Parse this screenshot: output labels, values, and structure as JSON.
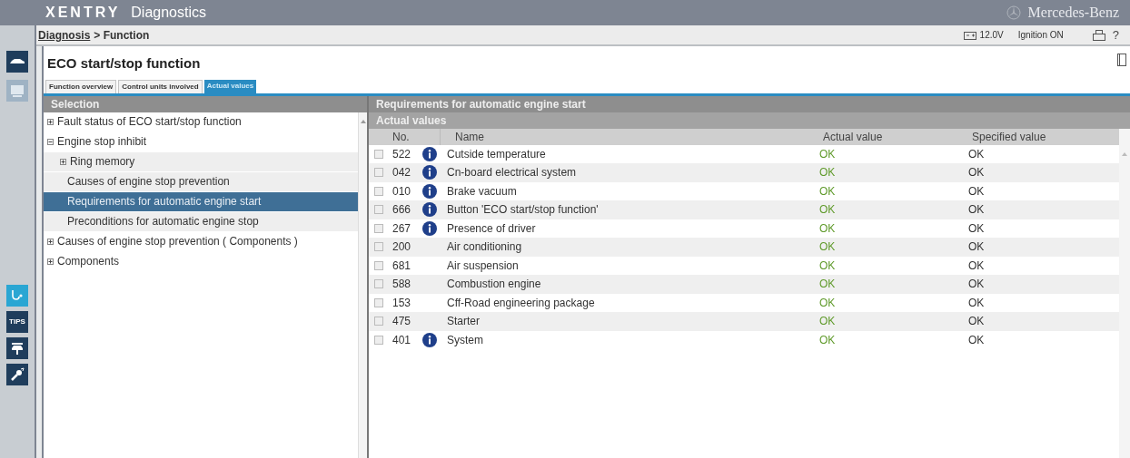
{
  "app": {
    "brand": "XENTRY",
    "title": "Diagnostics",
    "maker": "Mercedes-Benz"
  },
  "breadcrumb": {
    "link": "Diagnosis",
    "current": "> Function"
  },
  "status": {
    "voltage": "12.0V",
    "ignition": "Ignition ON"
  },
  "help": "?",
  "sidebar": {
    "top": [
      {
        "kind": "car",
        "disabled": false
      },
      {
        "kind": "screen",
        "disabled": true
      }
    ],
    "bottom": [
      {
        "kind": "stethoscope",
        "selected": true
      },
      {
        "kind": "tips",
        "label": "TIPS",
        "selected": false
      },
      {
        "kind": "lift",
        "selected": false
      },
      {
        "kind": "wrench",
        "selected": false
      }
    ]
  },
  "page_title": "ECO start/stop function",
  "tabs": [
    {
      "label": "Function overview",
      "selected": false
    },
    {
      "label": "Control units involved",
      "selected": false
    },
    {
      "label": "Actual values",
      "selected": true
    }
  ],
  "selection": {
    "title": "Selection",
    "items": [
      {
        "label": "Fault status of ECO start/stop function",
        "expanded": false,
        "selected": false
      },
      {
        "label": "Engine stop inhibit",
        "expanded": true,
        "selected": false,
        "children": [
          {
            "label": "Ring memory",
            "expanded": false,
            "selected": false
          },
          {
            "label": "Causes of engine stop prevention",
            "selected": false
          },
          {
            "label": "Requirements for automatic engine start",
            "selected": true
          },
          {
            "label": "Preconditions for automatic engine stop",
            "selected": false
          }
        ]
      },
      {
        "label": "Causes of engine stop prevention ( Components )",
        "expanded": false,
        "selected": false
      },
      {
        "label": "Components",
        "expanded": false,
        "selected": false
      }
    ]
  },
  "detail": {
    "title": "Requirements for automatic engine start",
    "subtitle": "Actual values",
    "columns": [
      "No.",
      "Name",
      "Actual value",
      "Specified value"
    ],
    "rows": [
      {
        "checked": false,
        "no": "522",
        "info": true,
        "name": "Cutside temperature",
        "actual": "OK",
        "specified": "OK"
      },
      {
        "checked": false,
        "no": "042",
        "info": true,
        "name": "Cn-board electrical system",
        "actual": "OK",
        "specified": "OK"
      },
      {
        "checked": false,
        "no": "010",
        "info": true,
        "name": "Brake vacuum",
        "actual": "OK",
        "specified": "OK"
      },
      {
        "checked": false,
        "no": "666",
        "info": true,
        "name": "Button 'ECO start/stop function'",
        "actual": "OK",
        "specified": "OK"
      },
      {
        "checked": false,
        "no": "267",
        "info": true,
        "name": "Presence of driver",
        "actual": "OK",
        "specified": "OK"
      },
      {
        "checked": false,
        "no": "200",
        "info": false,
        "name": "Air conditioning",
        "actual": "OK",
        "specified": "OK"
      },
      {
        "checked": false,
        "no": "681",
        "info": false,
        "name": "Air suspension",
        "actual": "OK",
        "specified": "OK"
      },
      {
        "checked": false,
        "no": "588",
        "info": false,
        "name": "Combustion engine",
        "actual": "OK",
        "specified": "OK"
      },
      {
        "checked": false,
        "no": "153",
        "info": false,
        "name": "Cff-Road engineering package",
        "actual": "OK",
        "specified": "OK"
      },
      {
        "checked": false,
        "no": "475",
        "info": false,
        "name": "Starter",
        "actual": "OK",
        "specified": "OK"
      },
      {
        "checked": false,
        "no": "401",
        "info": true,
        "name": "System",
        "actual": "OK",
        "specified": "OK"
      }
    ]
  }
}
